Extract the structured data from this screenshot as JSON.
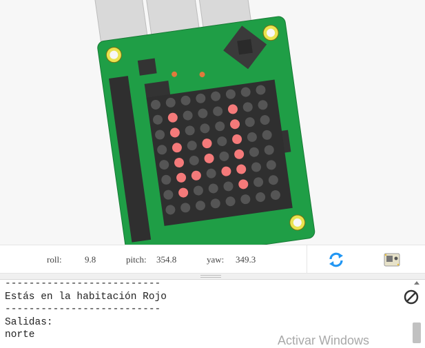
{
  "readout": {
    "roll_label": "roll:",
    "roll_value": "9.8",
    "pitch_label": "pitch:",
    "pitch_value": "354.8",
    "yaw_label": "yaw:",
    "yaw_value": "349.3"
  },
  "led_matrix": {
    "lit_color": "#f47a7a",
    "off_color": "#555555",
    "rows": [
      "00000000",
      "01000100",
      "01000100",
      "01010100",
      "01010100",
      "01101100",
      "01000100",
      "00000000"
    ]
  },
  "console": {
    "lines": [
      "--------------------------",
      "Estás en la habitación Rojo",
      "--------------------------",
      "Salidas:",
      "norte"
    ]
  },
  "watermark": "Activar Windows",
  "icons": {
    "refresh": "refresh-icon",
    "sense_hat": "sense-hat-icon",
    "stop": "stop-icon"
  },
  "colors": {
    "board_green": "#1f9e46",
    "accent_blue": "#2196f3"
  }
}
